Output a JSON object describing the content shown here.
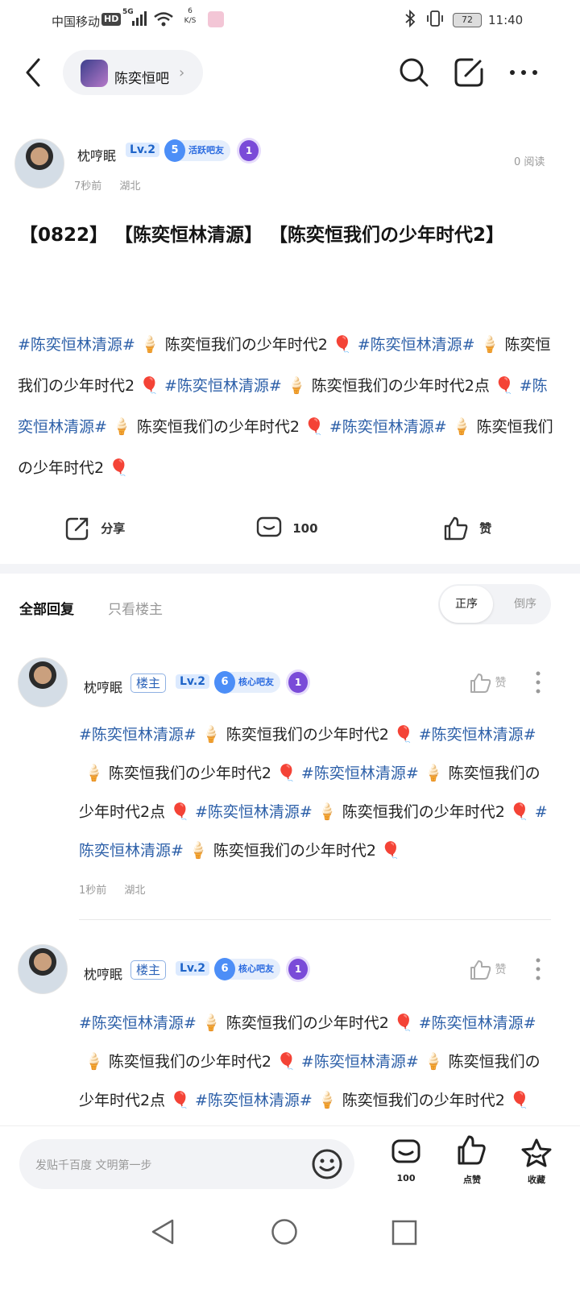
{
  "status_bar": {
    "carrier": "中国移动",
    "hd": "HD",
    "network": "5G",
    "speed_value": "6",
    "speed_unit": "K/S",
    "battery": "72",
    "time": "11:40"
  },
  "top_bar": {
    "forum_name": "陈奕恒吧"
  },
  "post": {
    "author": "枕哼眠",
    "level": "Lv.2",
    "fan_level": "5",
    "fan_title": "活跃吧友",
    "medal": "1",
    "time": "7秒前",
    "location": "湖北",
    "reads": "0 阅读",
    "title": "【0822】 【陈奕恒林清源】 【陈奕恒我们の少年时代2】",
    "body": [
      {
        "t": "tag",
        "v": "#陈奕恒林清源#"
      },
      {
        "t": "emo",
        "v": "🍦"
      },
      {
        "t": "txt",
        "v": "陈奕恒我们の少年时代2"
      },
      {
        "t": "emo",
        "v": "🎈"
      },
      {
        "t": "tag",
        "v": "#陈奕恒林清源#"
      },
      {
        "t": "emo",
        "v": "🍦"
      },
      {
        "t": "txt",
        "v": "陈奕恒我们の少年时代2"
      },
      {
        "t": "emo",
        "v": "🎈"
      },
      {
        "t": "tag",
        "v": "#陈奕恒林清源#"
      },
      {
        "t": "emo",
        "v": "🍦"
      },
      {
        "t": "txt",
        "v": "陈奕恒我们の少年时代2点"
      },
      {
        "t": "emo",
        "v": "🎈"
      },
      {
        "t": "tag",
        "v": "#陈奕恒林清源#"
      },
      {
        "t": "emo",
        "v": "🍦"
      },
      {
        "t": "txt",
        "v": "陈奕恒我们の少年时代2"
      },
      {
        "t": "emo",
        "v": "🎈"
      },
      {
        "t": "tag",
        "v": "#陈奕恒林清源#"
      },
      {
        "t": "emo",
        "v": "🍦"
      },
      {
        "t": "txt",
        "v": "陈奕恒我们の少年时代2"
      },
      {
        "t": "emo",
        "v": "🎈"
      }
    ]
  },
  "actions": {
    "share": "分享",
    "comments": "100",
    "like": "赞"
  },
  "tabs": {
    "all": "全部回复",
    "op_only": "只看楼主",
    "sort_asc": "正序",
    "sort_desc": "倒序"
  },
  "replies": [
    {
      "author": "枕哼眠",
      "badge": "楼主",
      "level": "Lv.2",
      "fan_level": "6",
      "fan_title": "核心吧友",
      "medal": "1",
      "like": "赞",
      "time": "1秒前",
      "location": "湖北",
      "body": [
        {
          "t": "tag",
          "v": "#陈奕恒林清源#"
        },
        {
          "t": "emo",
          "v": "🍦"
        },
        {
          "t": "txt",
          "v": "陈奕恒我们の少年时代2"
        },
        {
          "t": "emo",
          "v": "🎈"
        },
        {
          "t": "tag",
          "v": "#陈奕恒林清源#"
        },
        {
          "t": "emo",
          "v": "🍦"
        },
        {
          "t": "txt",
          "v": "陈奕恒我们の少年时代2"
        },
        {
          "t": "emo",
          "v": "🎈"
        },
        {
          "t": "tag",
          "v": "#陈奕恒林清源#"
        },
        {
          "t": "emo",
          "v": "🍦"
        },
        {
          "t": "txt",
          "v": "陈奕恒我们の少年时代2点"
        },
        {
          "t": "emo",
          "v": "🎈"
        },
        {
          "t": "tag",
          "v": "#陈奕恒林清源#"
        },
        {
          "t": "emo",
          "v": "🍦"
        },
        {
          "t": "txt",
          "v": "陈奕恒我们の少年时代2"
        },
        {
          "t": "emo",
          "v": "🎈"
        },
        {
          "t": "tag",
          "v": "#陈奕恒林清源#"
        },
        {
          "t": "emo",
          "v": "🍦"
        },
        {
          "t": "txt",
          "v": "陈奕恒我们の少年时代2"
        },
        {
          "t": "emo",
          "v": "🎈"
        }
      ]
    },
    {
      "author": "枕哼眠",
      "badge": "楼主",
      "level": "Lv.2",
      "fan_level": "6",
      "fan_title": "核心吧友",
      "medal": "1",
      "like": "赞",
      "body": [
        {
          "t": "tag",
          "v": "#陈奕恒林清源#"
        },
        {
          "t": "emo",
          "v": "🍦"
        },
        {
          "t": "txt",
          "v": "陈奕恒我们の少年时代2"
        },
        {
          "t": "emo",
          "v": "🎈"
        },
        {
          "t": "tag",
          "v": "#陈奕恒林清源#"
        },
        {
          "t": "emo",
          "v": "🍦"
        },
        {
          "t": "txt",
          "v": "陈奕恒我们の少年时代2"
        },
        {
          "t": "emo",
          "v": "🎈"
        },
        {
          "t": "tag",
          "v": "#陈奕恒林清源#"
        },
        {
          "t": "emo",
          "v": "🍦"
        },
        {
          "t": "txt",
          "v": "陈奕恒我们の少年时代2点"
        },
        {
          "t": "emo",
          "v": "🎈"
        },
        {
          "t": "tag",
          "v": "#陈奕恒林清源#"
        },
        {
          "t": "emo",
          "v": "🍦"
        },
        {
          "t": "txt",
          "v": "陈奕恒我们の少年时代2"
        },
        {
          "t": "emo",
          "v": "🎈"
        }
      ]
    }
  ],
  "bottom_bar": {
    "placeholder": "发贴千百度 文明第一步",
    "comments": "100",
    "like": "点赞",
    "favorite": "收藏"
  },
  "colors": {
    "link": "#2c5fa8",
    "accent": "#4c8ef7",
    "level_bg": "#dceaff"
  }
}
